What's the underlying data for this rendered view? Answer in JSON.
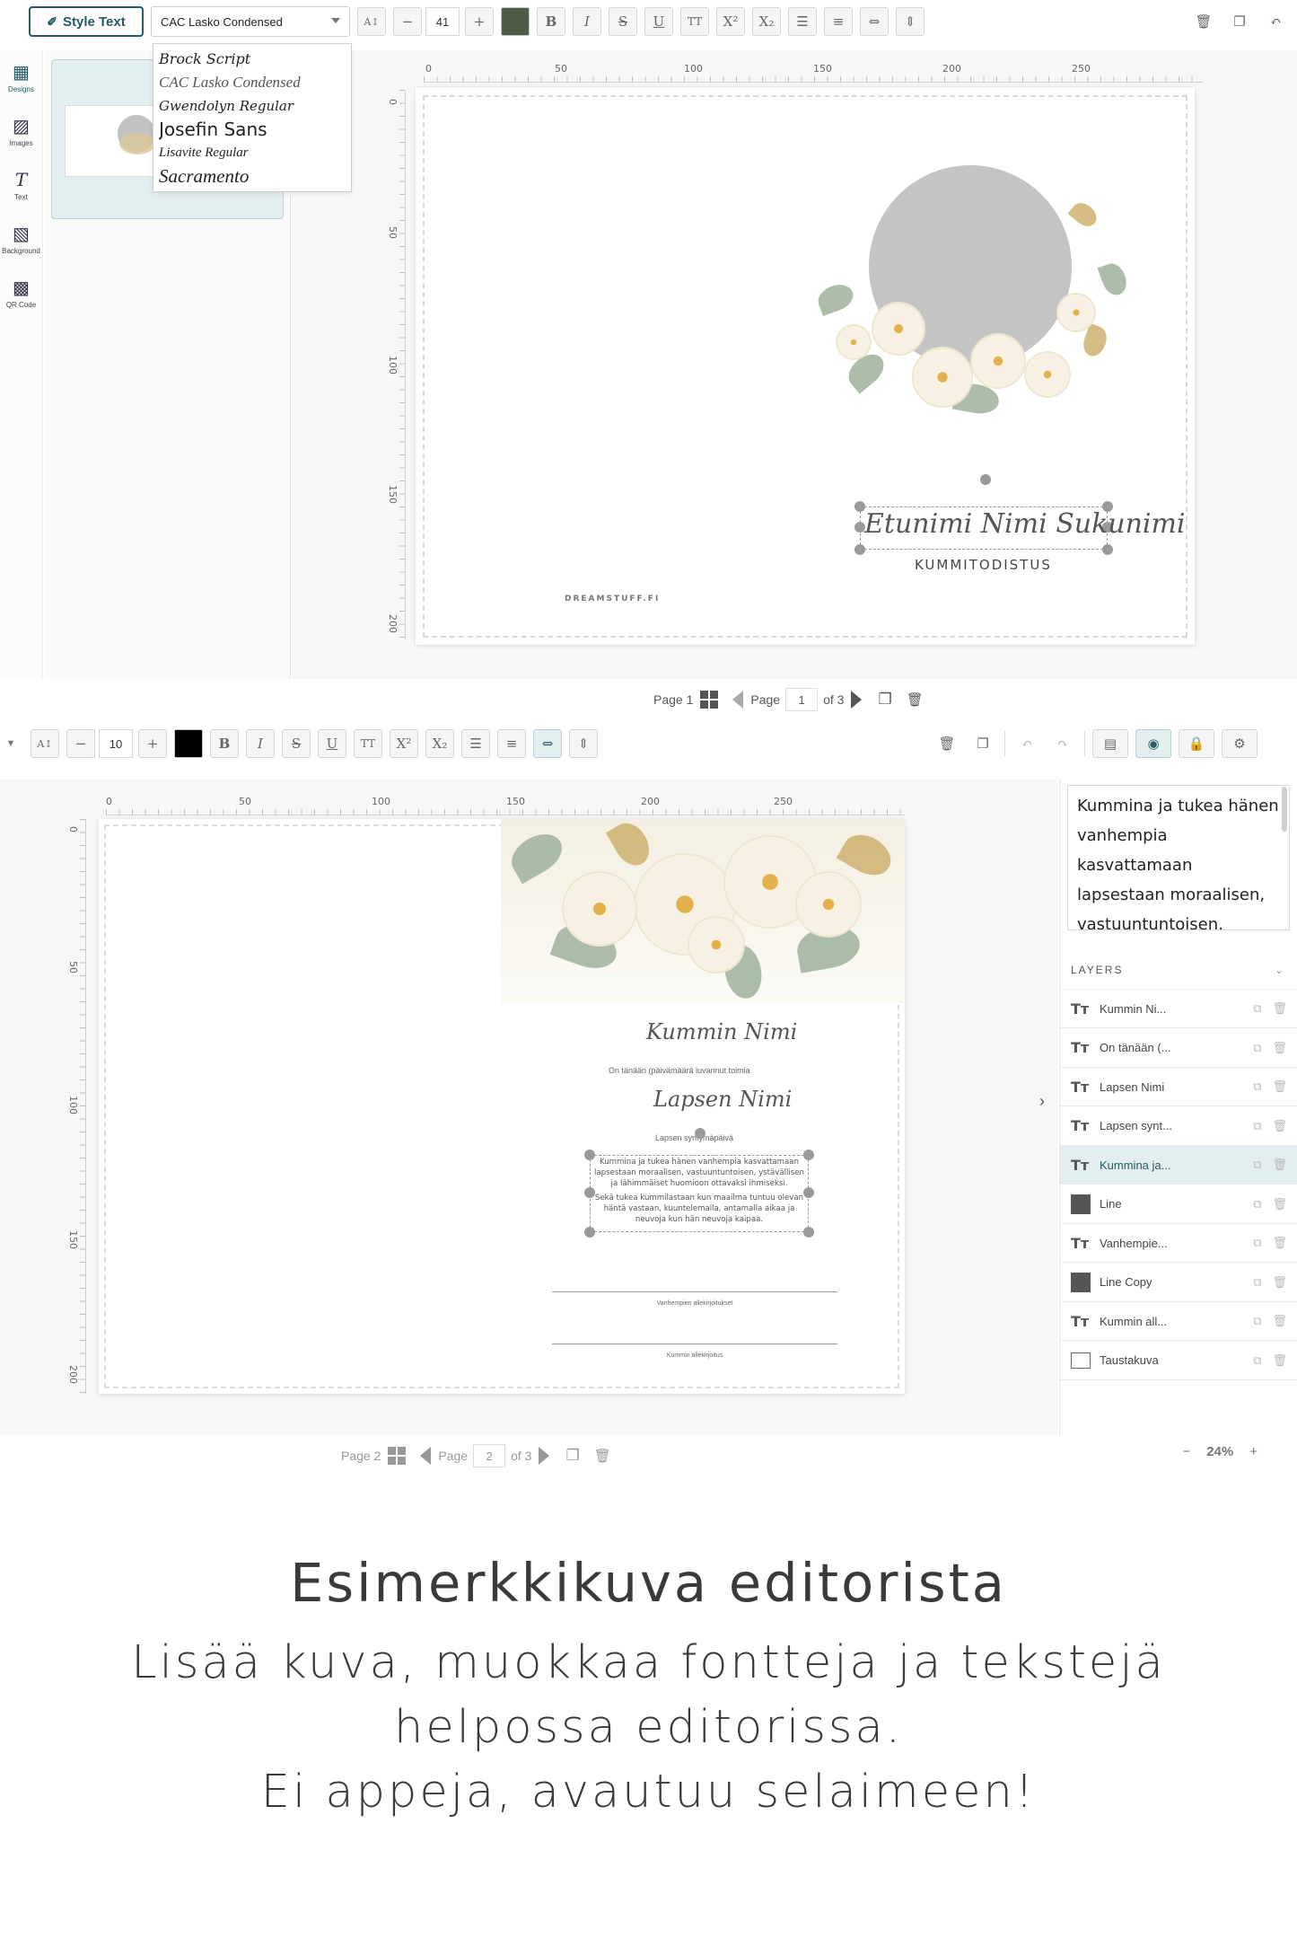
{
  "editor1": {
    "style_text_label": "Style Text",
    "font_value": "CAC Lasko Condensed",
    "font_options": [
      "Brock Script",
      "CAC Lasko Condensed",
      "Gwendolyn Regular",
      "Josefin Sans",
      "Lisavite Regular",
      "Sacramento"
    ],
    "font_size": "41",
    "text_color": "#4e5c46",
    "side_rail": [
      "Designs",
      "Images",
      "Text",
      "Background",
      "QR Code"
    ],
    "ruler_h": [
      "0",
      "50",
      "100",
      "150",
      "200",
      "250"
    ],
    "ruler_v": [
      "0",
      "50",
      "100",
      "150",
      "200"
    ],
    "card_name": "Etunimi Nimi Sukunimi",
    "card_subtitle": "KUMMITODISTUS",
    "card_brand": "DREAMSTUFF.FI",
    "pager": {
      "page_label": "Page 1",
      "page_word": "Page",
      "page_value": "1",
      "of_label": "of 3"
    }
  },
  "editor2": {
    "font_size": "10",
    "text_color": "#000000",
    "ruler_h": [
      "0",
      "50",
      "100",
      "150",
      "200",
      "250"
    ],
    "ruler_v": [
      "0",
      "50",
      "100",
      "150",
      "200"
    ],
    "card": {
      "godparent_name": "Kummin Nimi",
      "date_line": "On tänään (päivämäärä luvannut toimia",
      "child_name": "Lapsen Nimi",
      "birthdate_line": "Lapsen syntymäpäivä",
      "body_1": "Kummina ja tukea hänen vanhempia kasvattamaan lapsestaan moraalisen, vastuuntuntoisen, ystävällisen ja lähimmäiset huomioon ottavaksi ihmiseksi.",
      "body_2": "Sekä tukea kummilastaan kun maailma tuntuu olevan häntä vastaan, kuuntelemalla, antamalla aikaa ja neuvoja kun hän neuvoja kaipaa.",
      "sig_parents": "Vanhempien allekirjoitukset",
      "sig_godparent": "Kummin allekirjoitus"
    },
    "text_preview": "Kummina ja tukea hänen vanhempia kasvattamaan lapsestaan moraalisen, vastuuntuntoisen,",
    "layers_title": "LAYERS",
    "layers": [
      {
        "name": "Kummin Ni...",
        "kind": "text"
      },
      {
        "name": "On tänään (...",
        "kind": "text"
      },
      {
        "name": "Lapsen Nimi",
        "kind": "text"
      },
      {
        "name": "Lapsen synt...",
        "kind": "text"
      },
      {
        "name": "Kummina ja...",
        "kind": "text",
        "selected": true
      },
      {
        "name": "Line",
        "kind": "shape"
      },
      {
        "name": "Vanhempie...",
        "kind": "text"
      },
      {
        "name": "Line Copy",
        "kind": "shape"
      },
      {
        "name": "Kummin all...",
        "kind": "text"
      },
      {
        "name": "Taustakuva",
        "kind": "image"
      }
    ],
    "pager": {
      "page_label": "Page 2",
      "page_word": "Page",
      "page_value": "2",
      "of_label": "of 3"
    },
    "zoom": "24%"
  },
  "promo": {
    "title": "Esimerkkikuva editorista",
    "line1": "Lisää kuva, muokkaa fontteja ja tekstejä",
    "line2": "helpossa editorissa.",
    "line3": "Ei appeja, avautuu selaimeen!"
  },
  "colors": {
    "accent": "#275a63",
    "selected_bg": "#e3eef0"
  }
}
